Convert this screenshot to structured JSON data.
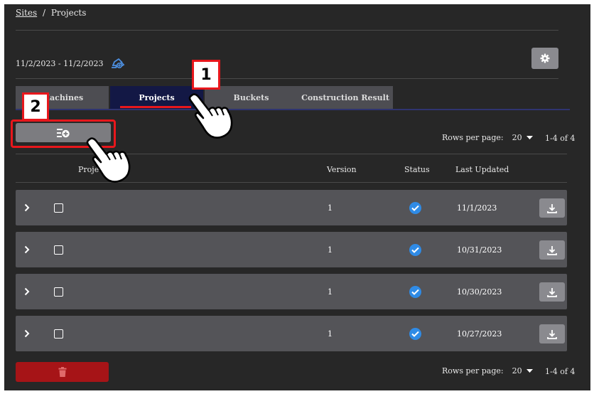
{
  "breadcrumb": {
    "root": "Sites",
    "separator": "/",
    "current": "Projects"
  },
  "date_range": "11/2/2023 - 11/2/2023",
  "tabs": [
    {
      "label": "Machines",
      "active": false
    },
    {
      "label": "Projects",
      "active": true
    },
    {
      "label": "Buckets",
      "active": false
    },
    {
      "label": "Construction Result",
      "active": false
    }
  ],
  "pagination": {
    "rows_per_page_label": "Rows per page:",
    "rows_per_page_value": "20",
    "range_text": "1-4 of 4"
  },
  "table": {
    "headers": {
      "name": "Project",
      "version": "Version",
      "status": "Status",
      "updated": "Last Updated"
    },
    "rows": [
      {
        "version": "1",
        "status": "complete",
        "last_updated": "11/1/2023"
      },
      {
        "version": "1",
        "status": "complete",
        "last_updated": "10/31/2023"
      },
      {
        "version": "1",
        "status": "complete",
        "last_updated": "10/30/2023"
      },
      {
        "version": "1",
        "status": "complete",
        "last_updated": "10/27/2023"
      }
    ]
  },
  "annotations": {
    "step1": "1",
    "step2": "2"
  },
  "icons": {
    "machine": "excavator-icon",
    "settings": "gear-icon",
    "add": "add-project-icon",
    "expand": "chevron-right-icon",
    "status": "check-circle-icon",
    "download": "download-icon",
    "delete": "trash-icon",
    "dropdown": "caret-down-icon",
    "pointer": "hand-pointer-icon"
  },
  "colors": {
    "background": "#272727",
    "active_tab": "#131845",
    "row": "#545458",
    "status_ok": "#2f8be6",
    "delete": "#a61417",
    "callout": "#e8171c"
  }
}
